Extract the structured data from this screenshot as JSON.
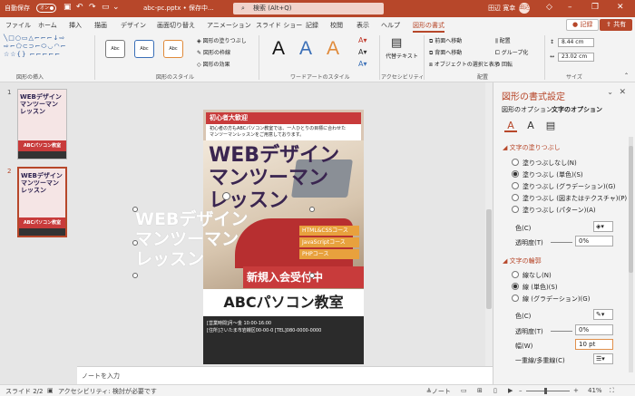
{
  "titlebar": {
    "autosave_label": "自動保存",
    "autosave_state": "オン",
    "filename": "abc-pc.pptx • 保存中...",
    "search_placeholder": "検索 (Alt+Q)",
    "user_name": "田辺 寛幸",
    "avatar_initials": "田辺",
    "buttons": {
      "minimize": "–",
      "restore": "❐",
      "close": "✕",
      "coauth": "◇"
    }
  },
  "tabs": [
    "ファイル",
    "ホーム",
    "挿入",
    "描画",
    "デザイン",
    "画面切り替え",
    "アニメーション",
    "スライド ショー",
    "記録",
    "校閲",
    "表示",
    "ヘルプ",
    "図形の書式"
  ],
  "active_tab": "図形の書式",
  "record_button": "● 記録",
  "share_button": "⇪ 共有",
  "ribbon": {
    "insert_shapes_label": "図形の挿入",
    "shape_glyphs": "╲□○▭△⌐⌐⌐↓⇨\n⇨⌐⬠⊂⊃⌐⬭◡◠⌐\n☆☆{} ⌐⌐⌐⌐⌐",
    "shape_style_label": "図形のスタイル",
    "style_samples": [
      "Abc",
      "Abc",
      "Abc"
    ],
    "fill": "図形の塗りつぶし",
    "outline": "図形の枠線",
    "effects": "図形の効果",
    "wordart_label": "ワードアートのスタイル",
    "wordart_samples": [
      "A",
      "A",
      "A"
    ],
    "accessibility_label": "アクセシビリティ",
    "alt_text": "代替テキスト",
    "forward": "前面へ移動",
    "backward": "背面へ移動",
    "selection_pane": "オブジェクトの選択と表示",
    "align": "配置",
    "group": "グループ化",
    "rotate": "回転",
    "arrange_label": "配置",
    "height": "8.44 cm",
    "width": "23.02 cm",
    "size_label": "サイズ"
  },
  "thumbnails": [
    {
      "num": "1",
      "title": "WEBデザイン\nマンツーマン\nレッスン",
      "banner": "ABCパソコン教室"
    },
    {
      "num": "2",
      "title": "WEBデザイン\nマンツーマン\nレッスン",
      "banner": "ABCパソコン教室"
    }
  ],
  "slide": {
    "header": "初心者大歓迎",
    "subtext": "初心者の方もABCパソコン教室では、一人ひとりの目標に合わせた\nマンツーマンレッスンをご用意しております。",
    "title": "WEBデザイン\nマンツーマン\nレッスン",
    "wordart_text": "WEBデザイン\nマンツーマン\nレッスン",
    "courses": [
      "HTML&CSSコース",
      "JavaScriptコース",
      "PHPコース"
    ],
    "banner": "新規入会受付中",
    "school": "ABCパソコン教室",
    "footer_lines": [
      "[営業時間]月～金 10:00-16:00",
      "[住所]さいたま市岩槻区00-00-0 [TEL]080-0000-0000"
    ]
  },
  "notes_placeholder": "ノートを入力",
  "pane": {
    "title": "図形の書式設定",
    "tab_shape": "図形のオプション",
    "tab_text": "文字のオプション",
    "fill_section": "文字の塗りつぶし",
    "fill_options": [
      "塗りつぶしなし(N)",
      "塗りつぶし (単色)(S)",
      "塗りつぶし (グラデーション)(G)",
      "塗りつぶし (図またはテクスチャ)(P)",
      "塗りつぶし (パターン)(A)"
    ],
    "fill_selected": 1,
    "color_label": "色(C)",
    "transparency_label": "透明度(T)",
    "fill_transparency": "0%",
    "outline_section": "文字の輪郭",
    "outline_options": [
      "線なし(N)",
      "線 (単色)(S)",
      "線 (グラデーション)(G)"
    ],
    "outline_selected": 1,
    "outline_transparency": "0%",
    "width_label": "幅(W)",
    "width_value": "10 pt",
    "compound_label": "一重線/多重線(C)"
  },
  "status": {
    "slide": "スライド 2/2",
    "accessibility": "アクセシビリティ: 検討が必要です",
    "notes": "≜ノート",
    "zoom": "41%"
  }
}
